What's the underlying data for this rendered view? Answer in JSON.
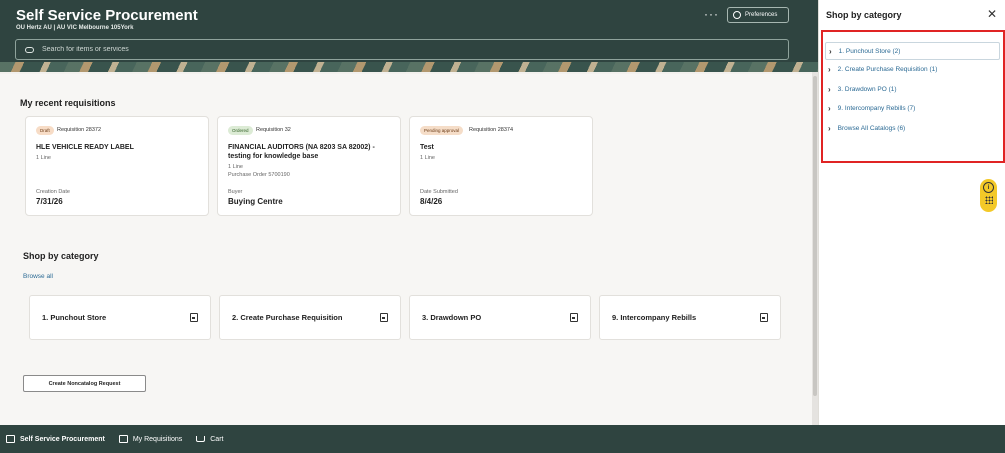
{
  "header": {
    "title": "Self Service Procurement",
    "subtitle": "OU Hertz AU | AU VIC Melbourne 105York",
    "more_label": "···",
    "preferences_label": "Preferences",
    "search_placeholder": "Search for items or services"
  },
  "recent": {
    "heading": "My recent requisitions",
    "cards": [
      {
        "status": "Draft",
        "requisition": "Requisition 28372",
        "title": "HLE VEHICLE READY LABEL",
        "lines": "1 Line",
        "sub": "",
        "field_label": "Creation Date",
        "field_value": "7/31/26"
      },
      {
        "status": "Ordered",
        "requisition": "Requisition 32",
        "title": "FINANCIAL AUDITORS (NA 8203 SA 82002) - testing for knowledge base",
        "lines": "1 Line",
        "sub": "Purchase Order 5700190",
        "field_label": "Buyer",
        "field_value": "Buying Centre"
      },
      {
        "status": "Pending approval",
        "requisition": "Requisition 28374",
        "title": "Test",
        "lines": "1 Line",
        "sub": "",
        "field_label": "Date Submitted",
        "field_value": "8/4/26"
      }
    ]
  },
  "shop": {
    "heading": "Shop by category",
    "browse_all": "Browse all",
    "categories": [
      "1. Punchout Store",
      "2. Create Purchase Requisition",
      "3. Drawdown PO",
      "9. Intercompany Rebills"
    ]
  },
  "noncatalog_button": "Create Noncatalog Request",
  "bottom_nav": {
    "items": [
      "Self Service Procurement",
      "My Requisitions",
      "Cart"
    ]
  },
  "panel": {
    "title": "Shop by category",
    "close": "✕",
    "items": [
      "1. Punchout Store (2)",
      "2. Create Purchase Requisition (1)",
      "3. Drawdown PO (1)",
      "9. Intercompany Rebills (7)",
      "Browse All Catalogs (6)"
    ]
  },
  "helper": {
    "info_glyph": "i"
  }
}
